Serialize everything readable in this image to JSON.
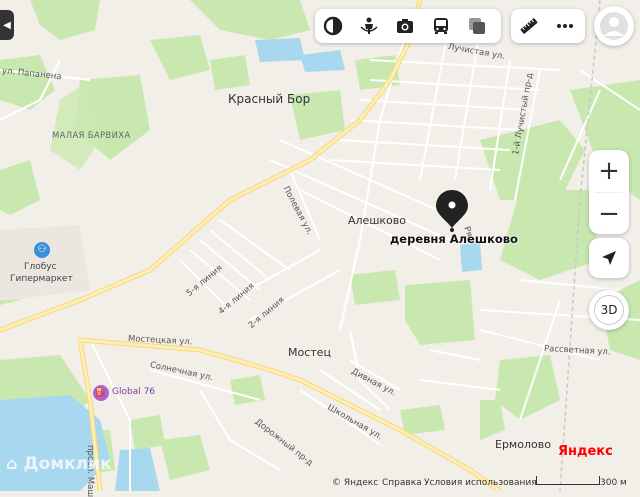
{
  "toolbar": {
    "left_items": [
      {
        "name": "layers-circle-icon"
      },
      {
        "name": "panorama-man-icon"
      },
      {
        "name": "camera-photo-icon"
      },
      {
        "name": "public-transport-bus-icon"
      },
      {
        "name": "traffic-square-icon"
      }
    ],
    "right_items": [
      {
        "name": "ruler-icon"
      },
      {
        "name": "more-dots-icon"
      }
    ]
  },
  "controls": {
    "zoom_in": "+",
    "zoom_out": "−",
    "mode_3d": "3D"
  },
  "places": {
    "krasny_bor": "Красный Бор",
    "malaya_barvikha": "МАЛАЯ БАРВИХА",
    "aleshkovo": "Алешково",
    "marker_label": "деревня Алешково",
    "mostets": "Мостец",
    "ermolovo": "Ермолово"
  },
  "pois": {
    "globus_line1": "Глобус",
    "globus_line2": "Гипермаркет",
    "global76": "Global 76"
  },
  "streets": {
    "papanena": "ул. Папанена",
    "luchistaya": "Лучистая ул.",
    "lucheystyi_pr": "1-й Лучистый пр-д",
    "polevaya": "Полевая ул.",
    "line5": "5-я линия",
    "line4": "4-я линия",
    "line2": "2-я линия",
    "mosteckaya": "Мостецкая ул.",
    "solnechnaya": "Солнечная ул.",
    "divnaya": "Дивная ул.",
    "shkolnaya": "Школьная ул.",
    "dorozhny": "Дорожный пр-д",
    "rassvetnaya": "Рассветная ул.",
    "masha": "просп. Маш",
    "ryab": "Ря"
  },
  "footer": {
    "copyright": "© Яндекс",
    "help": "Справка",
    "terms": "Условия использования",
    "scale": "300 м",
    "brand": "Яндекс",
    "watermark": "Домклик"
  },
  "colors": {
    "land": "#f2efe9",
    "forest": "#c9e8b0",
    "water": "#a8d8f0",
    "road_main": "#fae8a4",
    "road_minor": "#ffffff",
    "brand_red": "#ff0000"
  }
}
